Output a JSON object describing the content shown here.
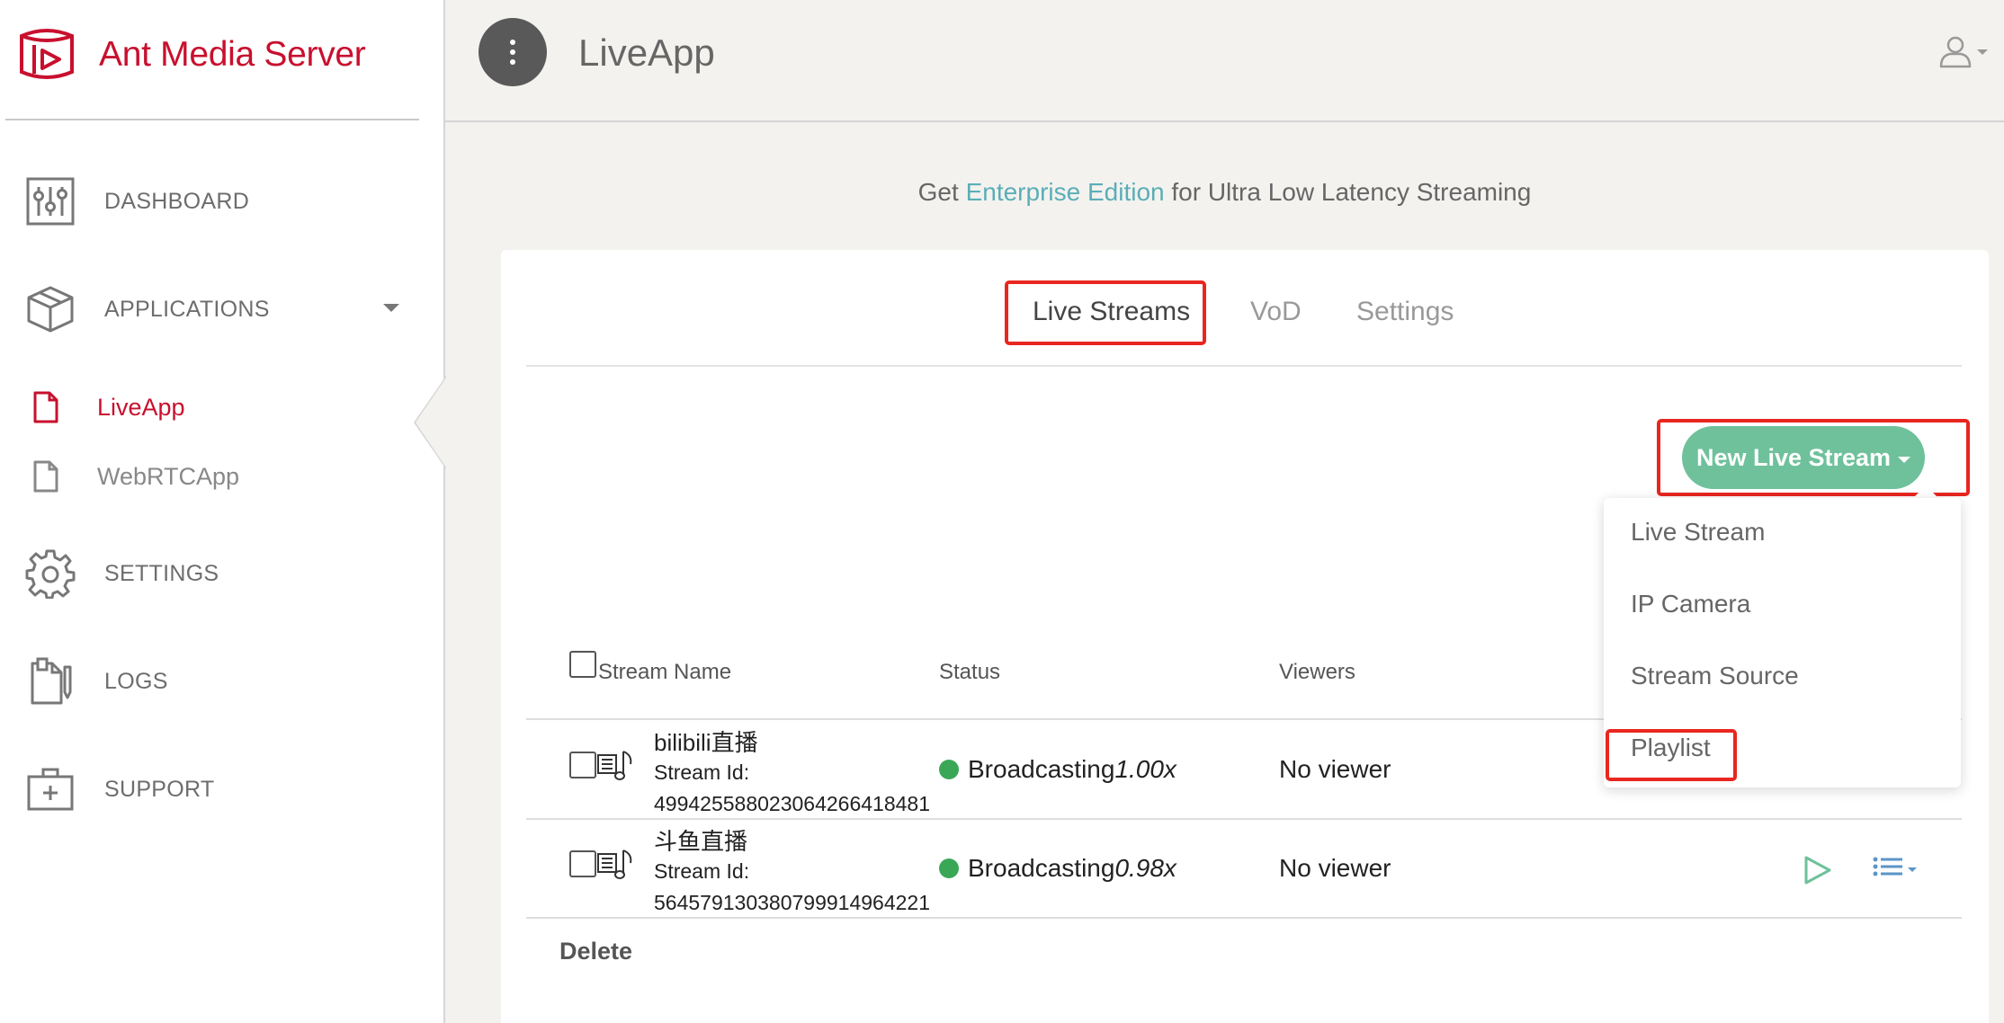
{
  "brand": {
    "name": "Ant Media Server"
  },
  "sidebar": {
    "items": [
      {
        "label": "DASHBOARD",
        "icon": "sliders-icon"
      },
      {
        "label": "APPLICATIONS",
        "icon": "box-icon"
      },
      {
        "label": "SETTINGS",
        "icon": "gear-icon"
      },
      {
        "label": "LOGS",
        "icon": "logs-icon"
      },
      {
        "label": "SUPPORT",
        "icon": "first-aid-kit-icon"
      }
    ],
    "apps": [
      {
        "label": "LiveApp",
        "active": true
      },
      {
        "label": "WebRTCApp",
        "active": false
      }
    ]
  },
  "header": {
    "title": "LiveApp"
  },
  "promo": {
    "prefix": "Get ",
    "link": "Enterprise Edition",
    "suffix": " for Ultra Low Latency Streaming"
  },
  "tabs": [
    {
      "label": "Live Streams",
      "active": true
    },
    {
      "label": "VoD",
      "active": false
    },
    {
      "label": "Settings",
      "active": false
    }
  ],
  "new_stream_button": {
    "label": "New Live Stream"
  },
  "dropdown": {
    "items": [
      "Live Stream",
      "IP Camera",
      "Stream Source",
      "Playlist"
    ]
  },
  "table": {
    "headers": {
      "name": "Stream Name",
      "status": "Status",
      "viewers": "Viewers"
    },
    "rows": [
      {
        "name": "bilibili直播",
        "id_label": "Stream Id:",
        "id": "499425588023064266418481",
        "status": "Broadcasting",
        "speed": "1.00x",
        "viewers": "No viewer"
      },
      {
        "name": "斗鱼直播",
        "id_label": "Stream Id:",
        "id": "564579130380799914964221",
        "status": "Broadcasting",
        "speed": "0.98x",
        "viewers": "No viewer"
      }
    ],
    "delete_label": "Delete"
  },
  "colors": {
    "brand": "#c8102e",
    "accent_green": "#6ec19b",
    "link": "#5aaeb6",
    "highlight": "#e8261f",
    "status_ok": "#3aa757"
  }
}
